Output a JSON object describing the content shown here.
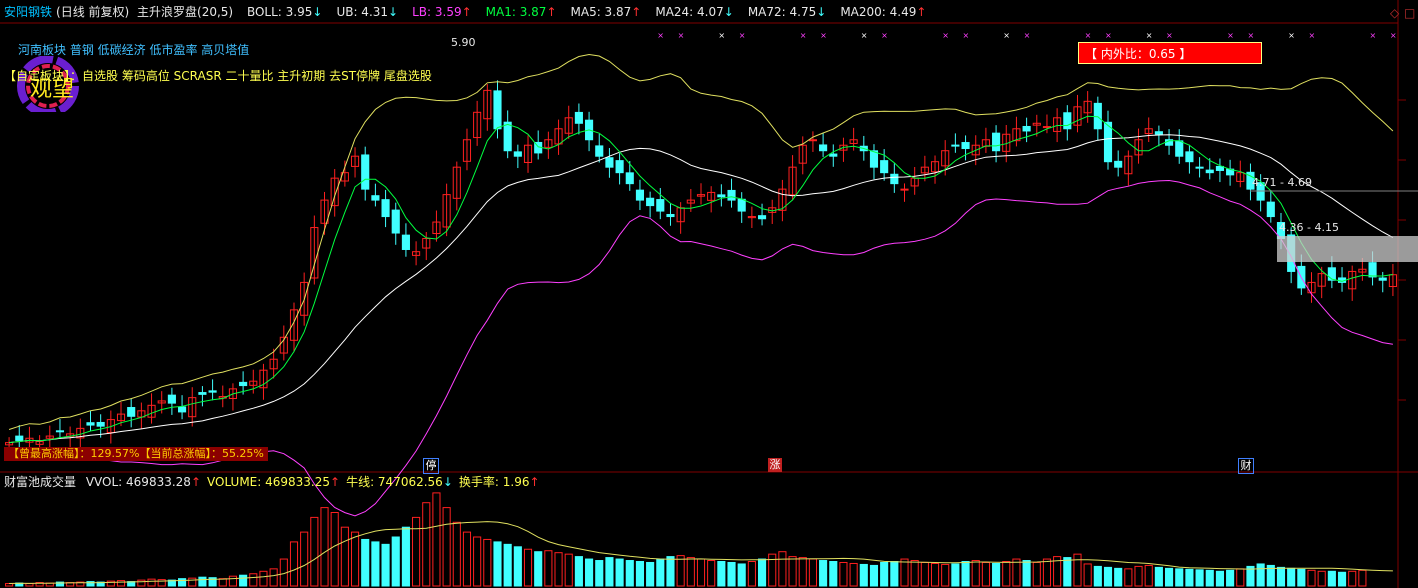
{
  "header": {
    "stock_name": "安阳钢铁",
    "mode": "(日线 前复权)",
    "indicator_name": "主升浪罗盘(20,5)",
    "items": [
      {
        "label": "BOLL: 3.95",
        "arrow": "↓",
        "color": "#e8e8e8"
      },
      {
        "label": "UB: 4.31",
        "arrow": "↓",
        "color": "#e8e8e8"
      },
      {
        "label": "LB: 3.59",
        "arrow": "↑",
        "color": "#ff40ff"
      },
      {
        "label": "MA1: 3.87",
        "arrow": "↑",
        "color": "#00ff40"
      },
      {
        "label": "MA5: 3.87",
        "arrow": "↑",
        "color": "#e8e8e8"
      },
      {
        "label": "MA24: 4.07",
        "arrow": "↓",
        "color": "#e8e8e8"
      },
      {
        "label": "MA72: 4.75",
        "arrow": "↓",
        "color": "#e8e8e8"
      },
      {
        "label": "MA200: 4.49",
        "arrow": "↑",
        "color": "#e8e8e8"
      }
    ]
  },
  "boards": {
    "line1": "河南板块 普钢 低碳经济 低市盈率 高贝塔值",
    "line2_prefix": "【自定板块】：",
    "line2": "自选股 筹码高位 SCRASR 二十量比 主升初期 去ST停牌 尾盘选股"
  },
  "logo": {
    "text": "观望"
  },
  "badge": {
    "text": "【 内外比：0.65 】"
  },
  "annotations": {
    "peak": "5.90",
    "range1": "4.71 - 4.69",
    "range2": "4.36 - 4.15"
  },
  "footer": {
    "text": "【曾最高涨幅】：129.57%【当前总涨幅】：55.25%"
  },
  "events": [
    {
      "text": "停"
    },
    {
      "text": "涨"
    },
    {
      "text": "财"
    }
  ],
  "volume_header": {
    "title": "财富池成交量",
    "items": [
      {
        "label": "VVOL: 469833.28",
        "arrow": "↑",
        "color": "#e8e8e8"
      },
      {
        "label": "VOLUME: 469833.25",
        "arrow": "↑",
        "color": "#ffff50"
      },
      {
        "label": "牛线: 747062.56",
        "arrow": "↓",
        "color": "#ffff50"
      },
      {
        "label": "换手率: 1.96",
        "arrow": "↑",
        "color": "#ffff50"
      }
    ]
  },
  "colors": {
    "up": "#ff2020",
    "down": "#40ffff",
    "boll_upper": "#e0e060",
    "boll_lower": "#ff40ff",
    "boll_mid": "#ffffff",
    "ma": "#00ff40",
    "grid": "#800000"
  },
  "chart_data": {
    "type": "candlestick",
    "price_range": [
      2.2,
      6.1
    ],
    "closes": [
      2.34,
      2.36,
      2.38,
      2.35,
      2.4,
      2.44,
      2.42,
      2.47,
      2.5,
      2.49,
      2.55,
      2.6,
      2.58,
      2.63,
      2.68,
      2.72,
      2.7,
      2.62,
      2.75,
      2.78,
      2.8,
      2.76,
      2.83,
      2.86,
      2.9,
      3.0,
      3.1,
      3.3,
      3.55,
      3.8,
      4.3,
      4.55,
      4.75,
      4.8,
      4.95,
      4.65,
      4.55,
      4.4,
      4.25,
      4.1,
      4.08,
      4.2,
      4.35,
      4.6,
      4.85,
      5.1,
      5.35,
      5.55,
      5.2,
      5.0,
      4.95,
      5.05,
      4.98,
      5.1,
      5.2,
      5.3,
      5.25,
      5.1,
      4.95,
      4.85,
      4.8,
      4.7,
      4.55,
      4.5,
      4.45,
      4.4,
      4.48,
      4.55,
      4.6,
      4.62,
      4.58,
      4.55,
      4.45,
      4.4,
      4.38,
      4.48,
      4.65,
      4.85,
      5.05,
      5.1,
      5.0,
      4.95,
      5.05,
      5.1,
      5.0,
      4.85,
      4.8,
      4.7,
      4.65,
      4.75,
      4.85,
      4.9,
      5.0,
      5.05,
      5.02,
      5.05,
      5.1,
      5.0,
      5.15,
      5.2,
      5.18,
      5.25,
      5.22,
      5.3,
      5.2,
      5.4,
      5.45,
      5.2,
      4.9,
      4.85,
      4.95,
      5.1,
      5.2,
      5.15,
      5.05,
      4.95,
      4.9,
      4.85,
      4.8,
      4.82,
      4.78,
      4.8,
      4.65,
      4.55,
      4.4,
      4.2,
      3.9,
      3.75,
      3.8,
      3.88,
      3.82,
      3.8,
      3.9,
      3.92,
      3.85,
      3.82,
      3.87
    ],
    "volumes": [
      5,
      6,
      5,
      7,
      6,
      8,
      7,
      8,
      9,
      8,
      10,
      11,
      9,
      12,
      14,
      13,
      12,
      15,
      16,
      18,
      17,
      15,
      20,
      22,
      25,
      30,
      35,
      55,
      90,
      110,
      140,
      160,
      150,
      120,
      110,
      95,
      90,
      85,
      100,
      120,
      140,
      170,
      190,
      160,
      130,
      110,
      100,
      95,
      90,
      85,
      80,
      75,
      70,
      72,
      68,
      65,
      60,
      55,
      52,
      58,
      55,
      52,
      50,
      48,
      55,
      60,
      62,
      58,
      55,
      52,
      50,
      48,
      45,
      50,
      55,
      65,
      70,
      60,
      58,
      55,
      52,
      50,
      48,
      46,
      44,
      42,
      48,
      50,
      55,
      52,
      48,
      46,
      44,
      45,
      50,
      52,
      48,
      46,
      50,
      55,
      52,
      48,
      55,
      60,
      58,
      65,
      45,
      40,
      38,
      36,
      35,
      40,
      42,
      38,
      36,
      35,
      34,
      33,
      32,
      30,
      32,
      35,
      40,
      45,
      42,
      38,
      36,
      34,
      32,
      30,
      30,
      28,
      30,
      32
    ],
    "series": [
      {
        "name": "BOLL",
        "key": "mid"
      },
      {
        "name": "UB",
        "key": "upper"
      },
      {
        "name": "LB",
        "key": "lower"
      }
    ]
  }
}
